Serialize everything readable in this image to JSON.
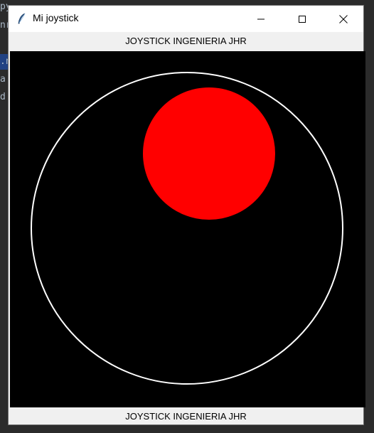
{
  "window": {
    "title": "Mi joystick",
    "icon": "feather-icon"
  },
  "labels": {
    "top": "JOYSTICK INGENIERIA JHR",
    "bottom": "JOYSTICK INGENIERIA JHR"
  },
  "background_editor": {
    "fragments": [
      "py",
      "nr",
      ".n",
      "a",
      "d"
    ]
  },
  "joystick": {
    "base_color": "#000000",
    "ring_color": "#ffffff",
    "knob_color": "#ff0000"
  },
  "colors": {
    "titlebar": "#ffffff",
    "window_bg": "#f0f0f0",
    "desktop_bg": "#2b2b2b"
  }
}
